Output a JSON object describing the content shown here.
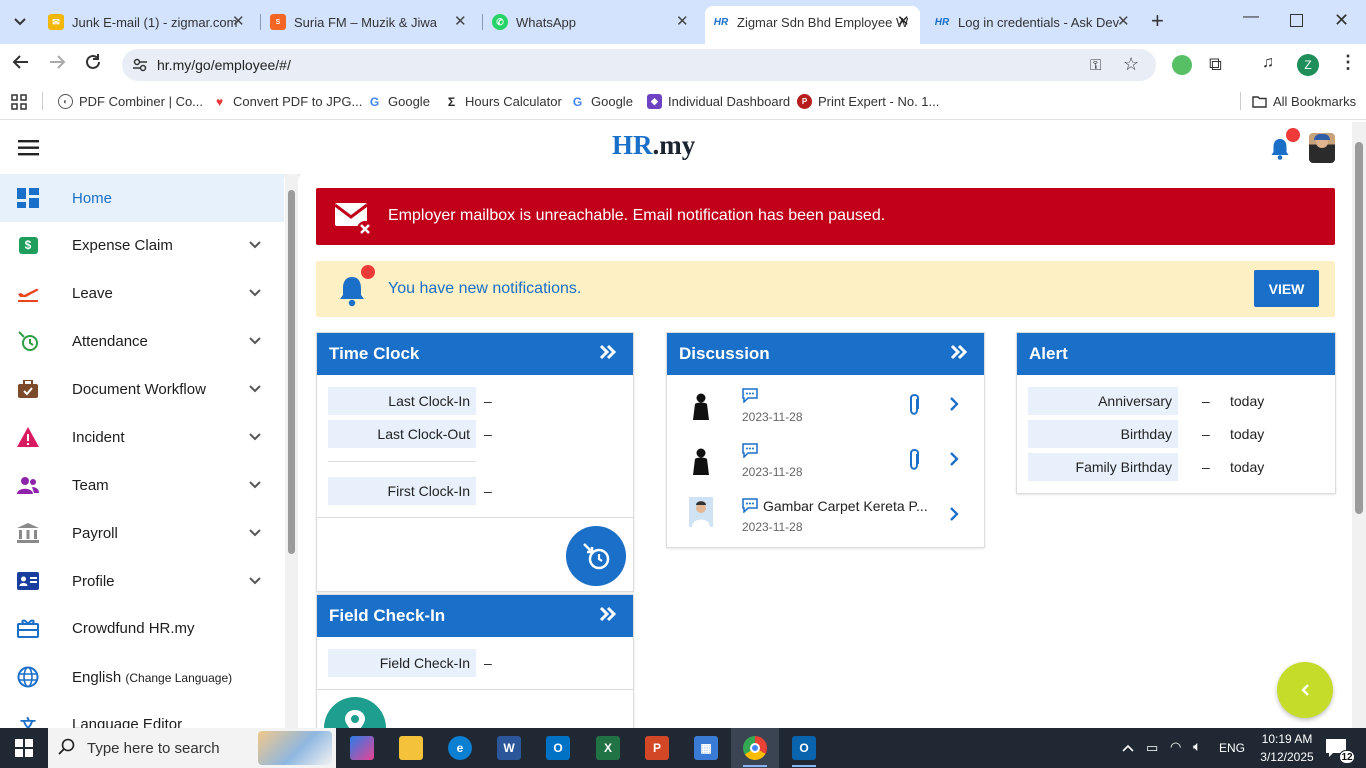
{
  "browser": {
    "tabs": [
      {
        "title": "Junk E-mail (1) - zigmar.com",
        "icon": "outlook-icon",
        "color": "#f2b705"
      },
      {
        "title": "Suria FM – Muzik & Jiwa",
        "icon": "suria-icon",
        "color": "#f26522"
      },
      {
        "title": "WhatsApp",
        "icon": "whatsapp-icon",
        "color": "#25d366"
      },
      {
        "title": "Zigmar Sdn Bhd Employee W",
        "icon": "hr-icon",
        "color": "#1a6fc9"
      },
      {
        "title": "Log in credentials - Ask Dev",
        "icon": "hr-icon",
        "color": "#1a6fc9"
      }
    ],
    "url": "hr.my/go/employee/#/",
    "profile_initial": "Z",
    "bookmarks": [
      {
        "label": "PDF Combiner | Co...",
        "icon": "pdf-icon",
        "color": "#555"
      },
      {
        "label": "Convert PDF to JPG...",
        "icon": "heart-icon",
        "color": "#e53935"
      },
      {
        "label": "Google",
        "icon": "google-icon",
        "color": "#4285f4"
      },
      {
        "label": "Hours Calculator",
        "icon": "sigma-icon",
        "color": "#222"
      },
      {
        "label": "Google",
        "icon": "google-icon",
        "color": "#4285f4"
      },
      {
        "label": "Individual Dashboard",
        "icon": "shield-icon",
        "color": "#6f42c1"
      },
      {
        "label": "Print Expert - No. 1...",
        "icon": "print-icon",
        "color": "#b71c1c"
      }
    ],
    "all_bookmarks": "All Bookmarks"
  },
  "app": {
    "logo_hr": "HR",
    "logo_domain": ".my",
    "accent": "#1a6fc9"
  },
  "sidebar": {
    "items": [
      {
        "label": "Home",
        "icon": "dashboard-icon",
        "color": "#1a6fc9",
        "chevron": false,
        "active": true
      },
      {
        "label": "Expense Claim",
        "icon": "dollar-icon",
        "color": "#1e9e5a",
        "chevron": true
      },
      {
        "label": "Leave",
        "icon": "plane-icon",
        "color": "#e8461e",
        "chevron": true
      },
      {
        "label": "Attendance",
        "icon": "clock-icon",
        "color": "#2e9e44",
        "chevron": true
      },
      {
        "label": "Document Workflow",
        "icon": "briefcase-icon",
        "color": "#7a4a2a",
        "chevron": true
      },
      {
        "label": "Incident",
        "icon": "warning-icon",
        "color": "#d81b60",
        "chevron": true
      },
      {
        "label": "Team",
        "icon": "people-icon",
        "color": "#8e24aa",
        "chevron": true
      },
      {
        "label": "Payroll",
        "icon": "bank-icon",
        "color": "#8a8a8a",
        "chevron": true
      },
      {
        "label": "Profile",
        "icon": "id-card-icon",
        "color": "#1a3e9e",
        "chevron": true
      },
      {
        "label": "Crowdfund HR.my",
        "icon": "gift-icon",
        "color": "#1a6fc9",
        "chevron": false
      },
      {
        "label": "English",
        "sublabel": "(Change Language)",
        "icon": "globe-icon",
        "color": "#1a6fc9",
        "chevron": false
      },
      {
        "label": "Language Editor",
        "icon": "translate-icon",
        "color": "#1a6fc9",
        "chevron": false
      }
    ]
  },
  "alerts": {
    "mailbox": "Employer mailbox is unreachable. Email notification has been paused.",
    "notifications": "You have new notifications.",
    "view_button": "VIEW"
  },
  "time_clock": {
    "title": "Time Clock",
    "rows": [
      {
        "label": "Last Clock-In",
        "value": "–"
      },
      {
        "label": "Last Clock-Out",
        "value": "–"
      },
      {
        "label": "First Clock-In",
        "value": "–"
      }
    ]
  },
  "field_checkin": {
    "title": "Field Check-In",
    "rows": [
      {
        "label": "Field Check-In",
        "value": "–"
      }
    ]
  },
  "discussion": {
    "title": "Discussion",
    "items": [
      {
        "title": "",
        "date": "2023-11-28",
        "attachment": true
      },
      {
        "title": "",
        "date": "2023-11-28",
        "attachment": true
      },
      {
        "title": "Gambar Carpet Kereta P...",
        "date": "2023-11-28",
        "attachment": false
      }
    ]
  },
  "alert_card": {
    "title": "Alert",
    "rows": [
      {
        "label": "Anniversary",
        "dash": "–",
        "value": "today"
      },
      {
        "label": "Birthday",
        "dash": "–",
        "value": "today"
      },
      {
        "label": "Family Birthday",
        "dash": "–",
        "value": "today"
      }
    ]
  },
  "taskbar": {
    "search_placeholder": "Type here to search",
    "language": "ENG",
    "time": "10:19 AM",
    "date": "3/12/2025",
    "notification_count": "12"
  }
}
